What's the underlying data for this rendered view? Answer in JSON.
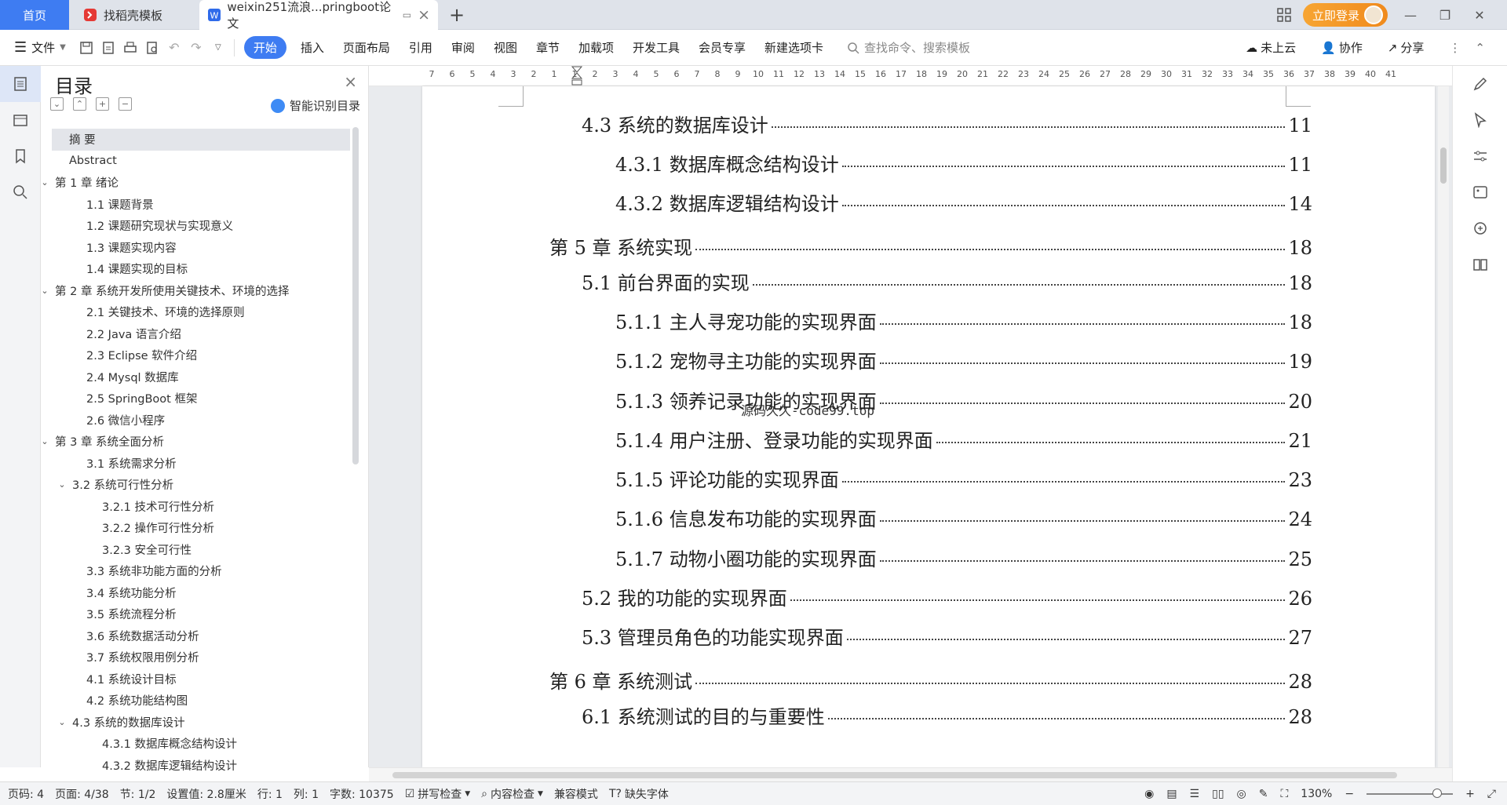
{
  "tabs": {
    "home": "首页",
    "template_tab": "找稻壳模板",
    "doc_tab": "weixin251流浪...pringboot论文"
  },
  "header": {
    "login_label": "立即登录"
  },
  "menubar": {
    "file": "文件",
    "items": [
      "开始",
      "插入",
      "页面布局",
      "引用",
      "审阅",
      "视图",
      "章节",
      "加载项",
      "开发工具",
      "会员专享",
      "新建选项卡"
    ],
    "search_placeholder": "查找命令、搜索模板",
    "cloud": "未上云",
    "collab": "协作",
    "share": "分享"
  },
  "outline": {
    "title": "目录",
    "smart_label": "智能识别目录",
    "items": [
      {
        "text": "摘  要",
        "level": 1,
        "arrow": ""
      },
      {
        "text": "Abstract",
        "level": 1,
        "arrow": ""
      },
      {
        "text": "第 1 章  绪论",
        "level": 1,
        "arrow": "v"
      },
      {
        "text": "1.1 课题背景",
        "level": 2,
        "arrow": ""
      },
      {
        "text": "1.2 课题研究现状与实现意义",
        "level": 2,
        "arrow": ""
      },
      {
        "text": "1.3 课题实现内容",
        "level": 2,
        "arrow": ""
      },
      {
        "text": "1.4 课题实现的目标",
        "level": 2,
        "arrow": ""
      },
      {
        "text": "第 2 章  系统开发所使用关键技术、环境的选择",
        "level": 1,
        "arrow": "v"
      },
      {
        "text": "2.1 关键技术、环境的选择原则",
        "level": 2,
        "arrow": ""
      },
      {
        "text": "2.2 Java 语言介绍",
        "level": 2,
        "arrow": ""
      },
      {
        "text": "2.3 Eclipse 软件介绍",
        "level": 2,
        "arrow": ""
      },
      {
        "text": "2.4 Mysql 数据库",
        "level": 2,
        "arrow": ""
      },
      {
        "text": "2.5 SpringBoot 框架",
        "level": 2,
        "arrow": ""
      },
      {
        "text": "2.6 微信小程序",
        "level": 2,
        "arrow": ""
      },
      {
        "text": "第 3 章  系统全面分析",
        "level": 1,
        "arrow": "v"
      },
      {
        "text": "3.1 系统需求分析",
        "level": 2,
        "arrow": ""
      },
      {
        "text": "3.2 系统可行性分析",
        "level": 2,
        "arrow": "v"
      },
      {
        "text": "3.2.1 技术可行性分析",
        "level": 3,
        "arrow": ""
      },
      {
        "text": "3.2.2 操作可行性分析",
        "level": 3,
        "arrow": ""
      },
      {
        "text": "3.2.3 安全可行性",
        "level": 3,
        "arrow": ""
      },
      {
        "text": "3.3 系统非功能方面的分析",
        "level": 2,
        "arrow": ""
      },
      {
        "text": "3.4 系统功能分析",
        "level": 2,
        "arrow": ""
      },
      {
        "text": "3.5 系统流程分析",
        "level": 2,
        "arrow": ""
      },
      {
        "text": "3.6 系统数据活动分析",
        "level": 2,
        "arrow": ""
      },
      {
        "text": "3.7 系统权限用例分析",
        "level": 2,
        "arrow": ""
      },
      {
        "text": "4.1 系统设计目标",
        "level": 2,
        "arrow": ""
      },
      {
        "text": "4.2 系统功能结构图",
        "level": 2,
        "arrow": ""
      },
      {
        "text": "4.3 系统的数据库设计",
        "level": 2,
        "arrow": "v"
      },
      {
        "text": "4.3.1 数据库概念结构设计",
        "level": 3,
        "arrow": ""
      },
      {
        "text": "4.3.2 数据库逻辑结构设计",
        "level": 3,
        "arrow": ""
      }
    ]
  },
  "ruler": {
    "numbers": [
      "7",
      "6",
      "5",
      "4",
      "3",
      "2",
      "1",
      "1",
      "2",
      "3",
      "4",
      "5",
      "6",
      "7",
      "8",
      "9",
      "10",
      "11",
      "12",
      "13",
      "14",
      "15",
      "16",
      "17",
      "18",
      "19",
      "20",
      "21",
      "22",
      "23",
      "24",
      "25",
      "26",
      "27",
      "28",
      "29",
      "30",
      "31",
      "32",
      "33",
      "34",
      "35",
      "36",
      "37",
      "38",
      "39",
      "40",
      "41"
    ]
  },
  "document": {
    "toc": [
      {
        "title": "4.3 系统的数据库设计",
        "page": "11",
        "level": 2
      },
      {
        "title": "4.3.1 数据库概念结构设计",
        "page": "11",
        "level": 3
      },
      {
        "title": "4.3.2 数据库逻辑结构设计",
        "page": "14",
        "level": 3
      },
      {
        "title": "第 5 章  系统实现",
        "page": "18",
        "level": 1
      },
      {
        "title": "5.1 前台界面的实现",
        "page": "18",
        "level": 2
      },
      {
        "title": "5.1.1 主人寻宠功能的实现界面",
        "page": "18",
        "level": 3
      },
      {
        "title": "5.1.2 宠物寻主功能的实现界面",
        "page": "19",
        "level": 3
      },
      {
        "title": "5.1.3 领养记录功能的实现界面",
        "page": "20",
        "level": 3
      },
      {
        "title": "5.1.4 用户注册、登录功能的实现界面",
        "page": "21",
        "level": 3
      },
      {
        "title": "5.1.5 评论功能的实现界面",
        "page": "23",
        "level": 3
      },
      {
        "title": "5.1.6 信息发布功能的实现界面",
        "page": "24",
        "level": 3
      },
      {
        "title": "5.1.7 动物小圈功能的实现界面",
        "page": "25",
        "level": 3
      },
      {
        "title": "5.2 我的功能的实现界面",
        "page": "26",
        "level": 2
      },
      {
        "title": "5.3 管理员角色的功能实现界面",
        "page": "27",
        "level": 2
      },
      {
        "title": "第 6 章  系统测试",
        "page": "28",
        "level": 1
      },
      {
        "title": "6.1 系统测试的目的与重要性",
        "page": "28",
        "level": 2
      }
    ],
    "watermark": "源码久久-code99.top"
  },
  "status": {
    "page_num": "页码: 4",
    "pages": "页面: 4/38",
    "section": "节: 1/2",
    "setting": "设置值: 2.8厘米",
    "row": "行: 1",
    "col": "列: 1",
    "words": "字数: 10375",
    "spell": "拼写检查",
    "content_check": "内容检查",
    "compat": "兼容模式",
    "missing_font": "缺失字体",
    "zoom": "130%",
    "zoom_level": 0.82
  },
  "colors": {
    "accent": "#3e7cf2",
    "login": "#f39a25"
  }
}
